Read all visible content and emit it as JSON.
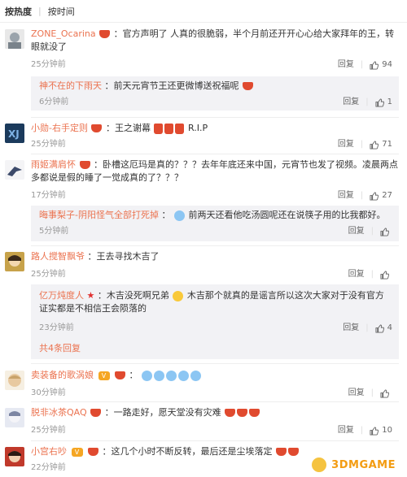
{
  "sort": {
    "hot": "按热度",
    "time": "按时间"
  },
  "actions": {
    "reply": "回复"
  },
  "comments": [
    {
      "name": "ZONE_Ocarina",
      "text": "：官方声明了 人真的很脆弱，半个月前还开开心心给大家拜年的王，转眼就没了",
      "time": "25分钟前",
      "likes": "94",
      "replies": [
        {
          "name": "神不在的下雨天",
          "text": "：前天元宵节王还更微博送祝福呢",
          "time": "6分钟前",
          "likes": "1"
        }
      ]
    },
    {
      "name": "小勋-右手定则",
      "text": "：王之谢幕",
      "text2": "R.I.P",
      "time": "25分钟前",
      "likes": "71"
    },
    {
      "name": "雨姬满肩怀",
      "text": "：卧槽这厄玛是真的？？？去年年底还来中国，元宵节也发了视频。凌晨两点多都说是假的睡了一觉成真的了？？？",
      "time": "17分钟前",
      "likes": "27",
      "replies": [
        {
          "name": "晦事梨子-阴阳怪气全部打死掉",
          "text": "前两天还看他吃汤圆呢还在说筷子用的比我都好。",
          "time": "5分钟前",
          "likes": ""
        }
      ]
    },
    {
      "name": "路人搅智飘爷",
      "text": "：王去寻找木吉了",
      "time": "25分钟前",
      "likes": "",
      "replies": [
        {
          "name": "亿万炖度人",
          "text": "：木吉没死啊兄弟",
          "text2": "木吉那个就真的是谣言所以这次大家对于没有官方证实都是不相信王会陨落的",
          "time": "23分钟前",
          "likes": "4"
        }
      ],
      "more": "共4条回复"
    },
    {
      "name": "卖装备的歌涡娘",
      "text": "：",
      "time": "30分钟前",
      "likes": ""
    },
    {
      "name": "脱非冰茶QAQ",
      "text": "：一路走好，愿天堂没有灾难",
      "time": "25分钟前",
      "likes": "10"
    },
    {
      "name": "小宫右吵",
      "text": "：这几个小时不断反转，最后还是尘埃落定",
      "time": "22分钟前",
      "likes": ""
    }
  ],
  "watermark": "3DMGAME",
  "colors": {
    "name": "#eb7350",
    "time": "#999999",
    "subbox": "#f2f2f5"
  }
}
